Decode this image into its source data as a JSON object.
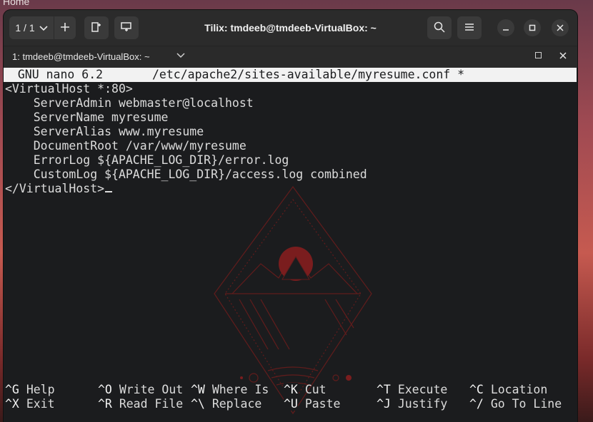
{
  "desktop": {
    "label": "Home"
  },
  "titlebar": {
    "tab_counter": "1 / 1",
    "title": "Tilix: tmdeeb@tmdeeb-VirtualBox: ~",
    "icons": [
      "chevron-down-icon",
      "plus-icon",
      "add-terminal-right-icon",
      "add-terminal-down-icon",
      "search-icon",
      "menu-icon",
      "minimize-icon",
      "maximize-icon",
      "close-icon"
    ]
  },
  "tab": {
    "label": "1: tmdeeb@tmdeeb-VirtualBox: ~"
  },
  "nano": {
    "header_left": "  GNU nano 6.2",
    "header_center": "/etc/apache2/sites-available/myresume.conf *",
    "lines": [
      "<VirtualHost *:80>",
      "    ServerAdmin webmaster@localhost",
      "    ServerName myresume",
      "    ServerAlias www.myresume",
      "    DocumentRoot /var/www/myresume",
      "    ErrorLog ${APACHE_LOG_DIR}/error.log",
      "    CustomLog ${APACHE_LOG_DIR}/access.log combined",
      "</VirtualHost>"
    ],
    "shortcuts_row1": [
      {
        "key": "^G",
        "label": "Help"
      },
      {
        "key": "^O",
        "label": "Write Out"
      },
      {
        "key": "^W",
        "label": "Where Is"
      },
      {
        "key": "^K",
        "label": "Cut"
      },
      {
        "key": "^T",
        "label": "Execute"
      },
      {
        "key": "^C",
        "label": "Location"
      }
    ],
    "shortcuts_row2": [
      {
        "key": "^X",
        "label": "Exit"
      },
      {
        "key": "^R",
        "label": "Read File"
      },
      {
        "key": "^\\",
        "label": "Replace"
      },
      {
        "key": "^U",
        "label": "Paste"
      },
      {
        "key": "^J",
        "label": "Justify"
      },
      {
        "key": "^/",
        "label": "Go To Line"
      }
    ]
  },
  "colors": {
    "terminal_bg": "#1b1c1e",
    "titlebar_bg": "#2b2b2b",
    "art_accent": "#8b1e1e"
  }
}
